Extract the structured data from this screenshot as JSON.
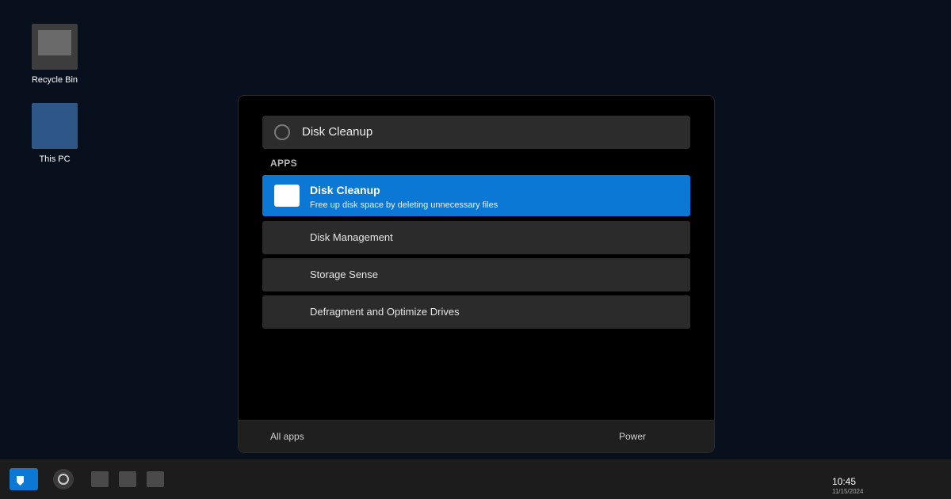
{
  "desktop": {
    "icons": [
      {
        "label": "Recycle Bin",
        "icon": "recycle-bin-icon"
      },
      {
        "label": "This PC",
        "icon": "computer-icon"
      }
    ]
  },
  "start_menu": {
    "search": {
      "value": "Disk Cleanup",
      "icon": "search-circle-icon"
    },
    "section_label": "APPS",
    "results": [
      {
        "title": "Disk Cleanup",
        "description": "Free up disk space by deleting unnecessary files",
        "selected": true,
        "icon": "disk-cleanup-app-icon"
      },
      {
        "title": "Disk Management",
        "selected": false
      },
      {
        "title": "Storage Sense",
        "selected": false
      },
      {
        "title": "Defragment and Optimize Drives",
        "selected": false
      }
    ],
    "footer": {
      "all_apps": "All apps",
      "power": "Power"
    }
  },
  "taskbar": {
    "start_icon": "start-shield-icon",
    "cortana_icon": "cortana-circle-icon",
    "pinned_apps": [
      "app-icon",
      "app-icon",
      "app-icon"
    ],
    "clock": {
      "time": "10:45",
      "date": "11/15/2024"
    }
  },
  "colors": {
    "accent": "#0a78d4",
    "desktop_bg": "#08101e",
    "panel_bg": "#000000",
    "taskbar_bg": "#1c1c1c"
  }
}
